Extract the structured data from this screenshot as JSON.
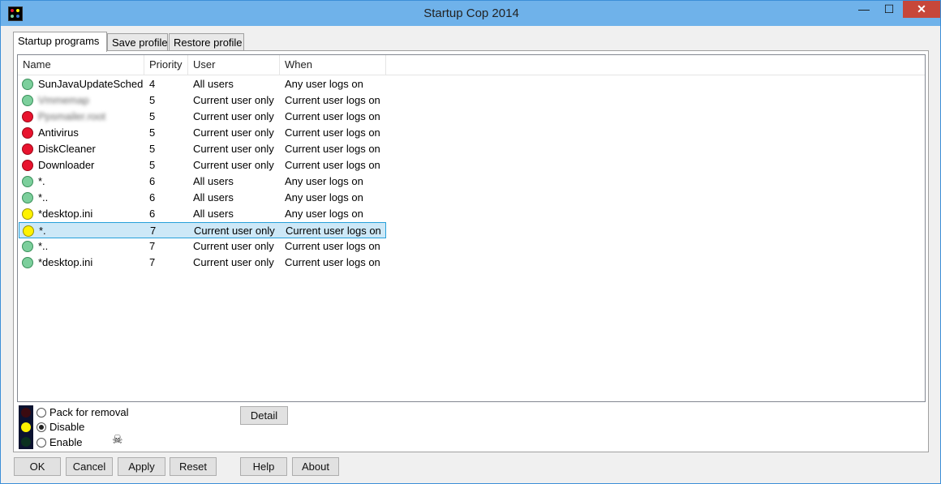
{
  "window": {
    "title": "Startup Cop 2014",
    "minimize_glyph": "—",
    "maximize_glyph": "☐",
    "close_glyph": "✕"
  },
  "tabs": [
    {
      "label": "Startup programs",
      "active": true
    },
    {
      "label": "Save profile",
      "active": false
    },
    {
      "label": "Restore profile",
      "active": false
    }
  ],
  "list": {
    "columns": [
      "Name",
      "Priority",
      "User",
      "When"
    ],
    "rows": [
      {
        "status": "green",
        "name": "SunJavaUpdateSched",
        "priority": "4",
        "user": "All users",
        "when": "Any user logs on"
      },
      {
        "status": "green",
        "name": "Vmmemap",
        "priority": "5",
        "user": "Current user only",
        "when": "Current user logs on",
        "obscured": true
      },
      {
        "status": "red",
        "name": "Ppsmailer.root",
        "priority": "5",
        "user": "Current user only",
        "when": "Current user logs on",
        "obscured": true
      },
      {
        "status": "red",
        "name": "Antivirus",
        "priority": "5",
        "user": "Current user only",
        "when": "Current user logs on"
      },
      {
        "status": "red",
        "name": "DiskCleaner",
        "priority": "5",
        "user": "Current user only",
        "when": "Current user logs on"
      },
      {
        "status": "red",
        "name": "Downloader",
        "priority": "5",
        "user": "Current user only",
        "when": "Current user logs on"
      },
      {
        "status": "green",
        "name": "*.",
        "priority": "6",
        "user": "All users",
        "when": "Any user logs on"
      },
      {
        "status": "green",
        "name": "*..",
        "priority": "6",
        "user": "All users",
        "when": "Any user logs on"
      },
      {
        "status": "yellow",
        "name": "*desktop.ini",
        "priority": "6",
        "user": "All users",
        "when": "Any user logs on"
      },
      {
        "status": "yellow",
        "name": "*.",
        "priority": "7",
        "user": "Current user only",
        "when": "Current user logs on",
        "selected": true
      },
      {
        "status": "green",
        "name": "*..",
        "priority": "7",
        "user": "Current user only",
        "when": "Current user logs on"
      },
      {
        "status": "green",
        "name": "*desktop.ini",
        "priority": "7",
        "user": "Current user only",
        "when": "Current user logs on"
      }
    ]
  },
  "status_options": [
    {
      "label": "Pack for removal",
      "checked": false
    },
    {
      "label": "Disable",
      "checked": true
    },
    {
      "label": "Enable",
      "checked": false
    }
  ],
  "detail_button": "Detail",
  "bottom_buttons": {
    "ok": "OK",
    "cancel": "Cancel",
    "apply": "Apply",
    "reset": "Reset",
    "help": "Help",
    "about": "About"
  },
  "colors": {
    "green": "#7ccf9c",
    "red": "#e8132e",
    "yellow": "#fff200",
    "selection": "#cde8f7"
  }
}
